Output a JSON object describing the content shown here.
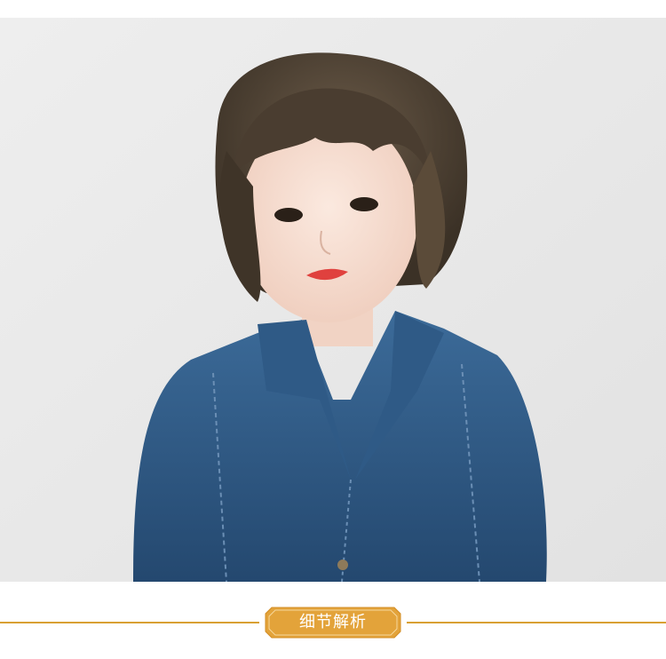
{
  "section": {
    "title": "细节解析"
  },
  "colors": {
    "accent": "#d9a033",
    "badge_fill": "#e3a33a",
    "badge_border": "#d38c24"
  },
  "photo": {
    "subject": "woman-with-bob-haircut-denim-jacket"
  }
}
